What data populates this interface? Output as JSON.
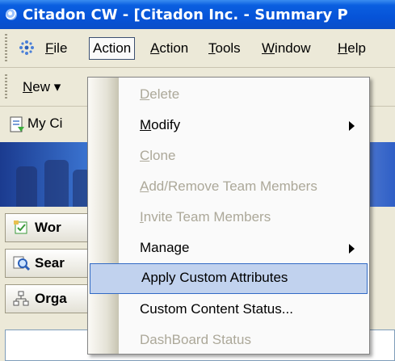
{
  "window": {
    "title": "Citadon CW - [Citadon Inc. - Summary P"
  },
  "menubar": {
    "items": [
      {
        "label": "File",
        "accel_index": 0
      },
      {
        "label": "Action",
        "accel_index": -1
      },
      {
        "label": "Action",
        "accel_index": 0
      },
      {
        "label": "Tools",
        "accel_index": 0
      },
      {
        "label": "Window",
        "accel_index": 0
      },
      {
        "label": "Help",
        "accel_index": 0
      }
    ]
  },
  "toolbar": {
    "new_label": "New",
    "new_dropdown_glyph": "▾"
  },
  "nav": {
    "my_citadon_label": "My Ci"
  },
  "panel": {
    "work_label": "Wor",
    "search_label": "Sear",
    "org_label": "Orga",
    "expander_glyph": "+"
  },
  "action_menu": {
    "items": [
      {
        "label": "Delete",
        "mnemonic": "D",
        "rest": "elete",
        "enabled": false,
        "submenu": false
      },
      {
        "label": "Modify",
        "mnemonic": "M",
        "rest": "odify",
        "enabled": true,
        "submenu": true
      },
      {
        "label": "Clone",
        "mnemonic": "C",
        "rest": "lone",
        "enabled": false,
        "submenu": false
      },
      {
        "label": "Add/Remove Team Members",
        "mnemonic": "A",
        "rest": "dd/Remove Team Members",
        "enabled": false,
        "submenu": false
      },
      {
        "label": "Invite Team Members",
        "mnemonic": "I",
        "rest": "nvite Team Members",
        "enabled": false,
        "submenu": false
      },
      {
        "label": "Manage",
        "mnemonic": "",
        "rest": "Manage",
        "enabled": true,
        "submenu": true
      },
      {
        "label": "Apply Custom Attributes",
        "mnemonic": "",
        "rest": "Apply Custom Attributes",
        "enabled": true,
        "submenu": false,
        "highlighted": true
      },
      {
        "label": "Custom Content Status...",
        "mnemonic": "",
        "rest": "Custom Content Status...",
        "enabled": true,
        "submenu": false
      },
      {
        "label": "DashBoard Status",
        "mnemonic": "",
        "rest": "DashBoard Status",
        "enabled": false,
        "submenu": false
      }
    ]
  },
  "colors": {
    "titlebar": "#0653d8",
    "menu_highlight": "#c1d2ee",
    "menu_highlight_border": "#316ac5",
    "disabled_text": "#aca899"
  }
}
